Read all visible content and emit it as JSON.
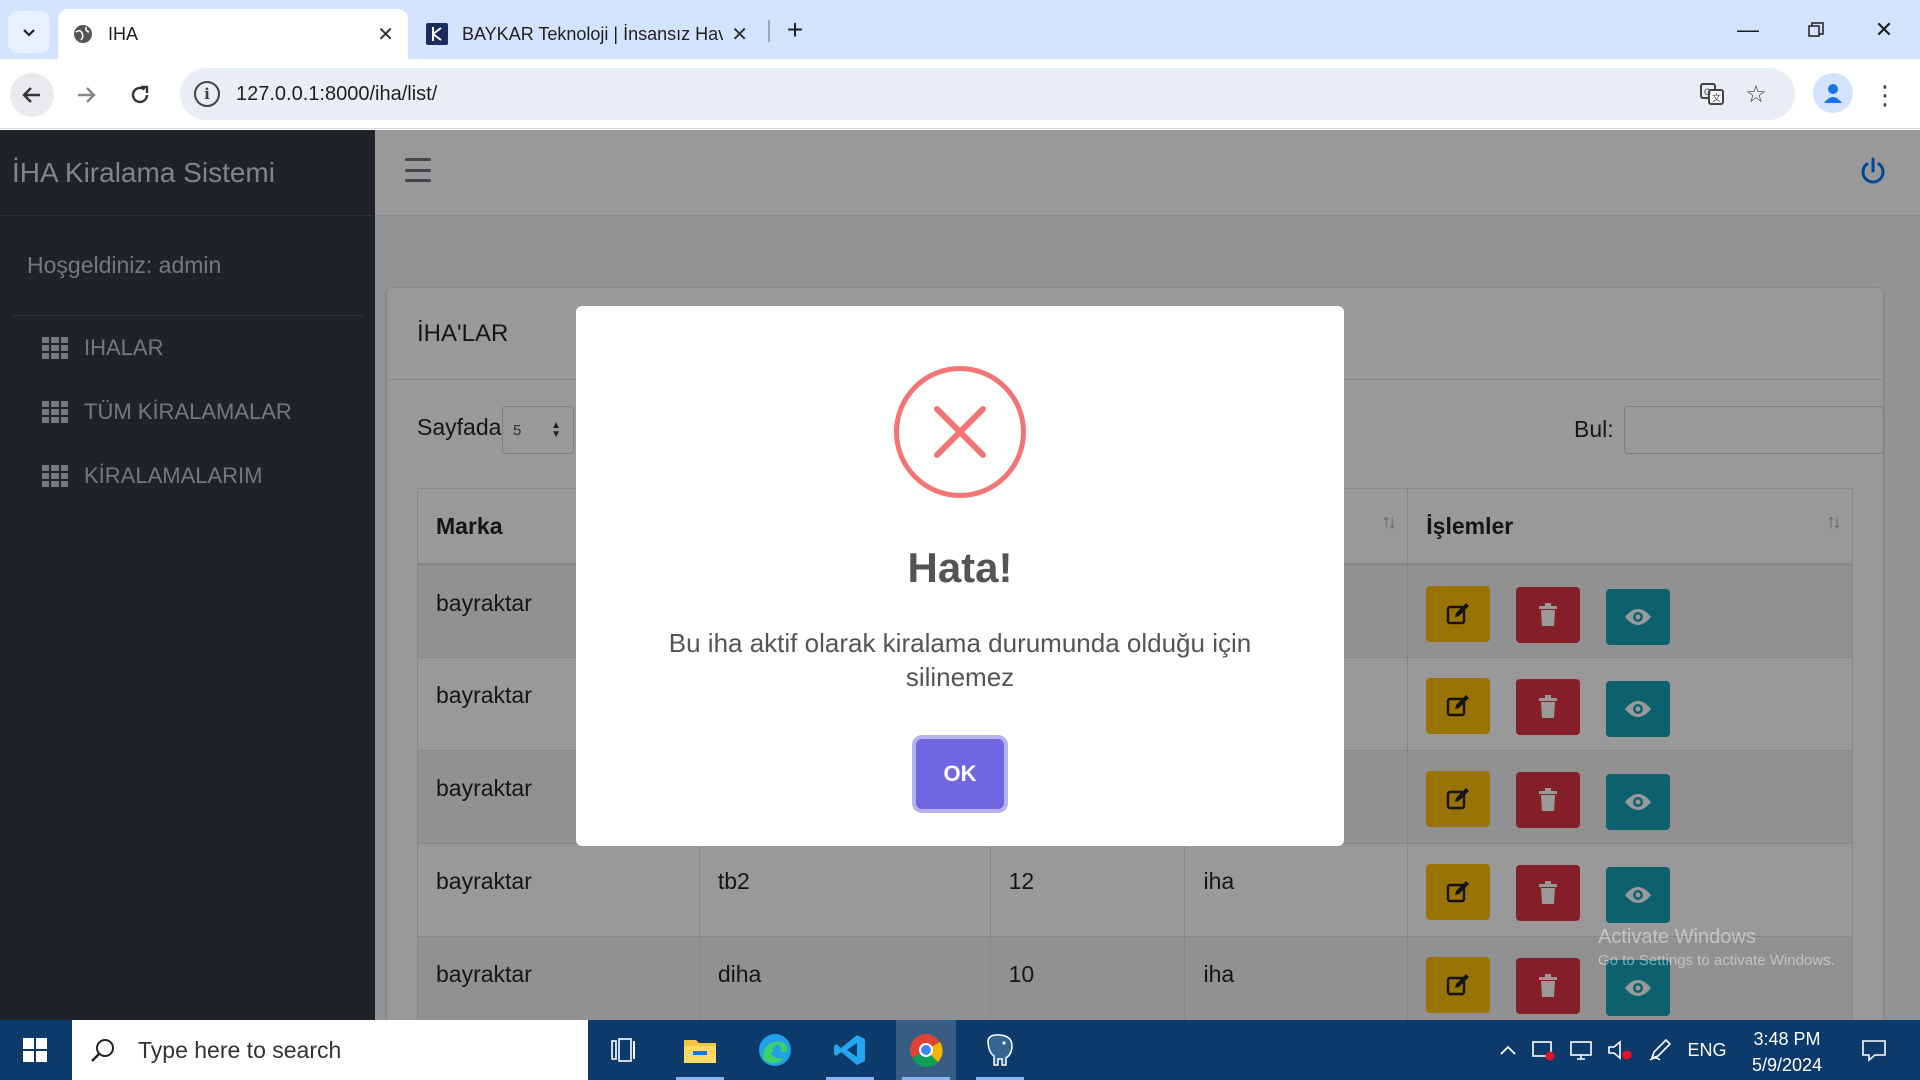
{
  "browser": {
    "tabs": [
      {
        "title": "IHA",
        "active": true
      },
      {
        "title": "BAYKAR Teknoloji | İnsansız Hav",
        "active": false
      }
    ],
    "url": "127.0.0.1:8000/iha/list/"
  },
  "app": {
    "brand": "İHA Kiralama Sistemi",
    "welcome": "Hoşgeldiniz: admin",
    "nav": [
      {
        "label": "IHALAR"
      },
      {
        "label": "TÜM KİRALAMALAR"
      },
      {
        "label": "KİRALAMALARIM"
      }
    ],
    "card_title": "İHA'LAR",
    "page_size_label": "Sayfada",
    "page_size_value": "5",
    "search_label": "Bul:",
    "table": {
      "headers": [
        "Marka",
        "",
        "",
        "",
        "İşlemler"
      ],
      "rows": [
        [
          "bayraktar",
          "",
          "",
          ""
        ],
        [
          "bayraktar",
          "",
          "",
          ""
        ],
        [
          "bayraktar",
          "",
          "",
          ""
        ],
        [
          "bayraktar",
          "tb2",
          "12",
          "iha"
        ],
        [
          "bayraktar",
          "diha",
          "10",
          "iha"
        ]
      ]
    },
    "watermark": {
      "line1": "Activate Windows",
      "line2": "Go to Settings to activate Windows."
    }
  },
  "modal": {
    "title": "Hata!",
    "message": "Bu iha aktif olarak kiralama durumunda olduğu için silinemez",
    "ok_label": "OK"
  },
  "taskbar": {
    "search_placeholder": "Type here to search",
    "language": "ENG",
    "time": "3:48 PM",
    "date": "5/9/2024"
  },
  "colors": {
    "sidebar": "#343a40",
    "edit_button": "#ffc107",
    "delete_button": "#dc3545",
    "view_button": "#17a2b8",
    "ok_button": "#7066e0",
    "error_icon": "#f27474"
  }
}
